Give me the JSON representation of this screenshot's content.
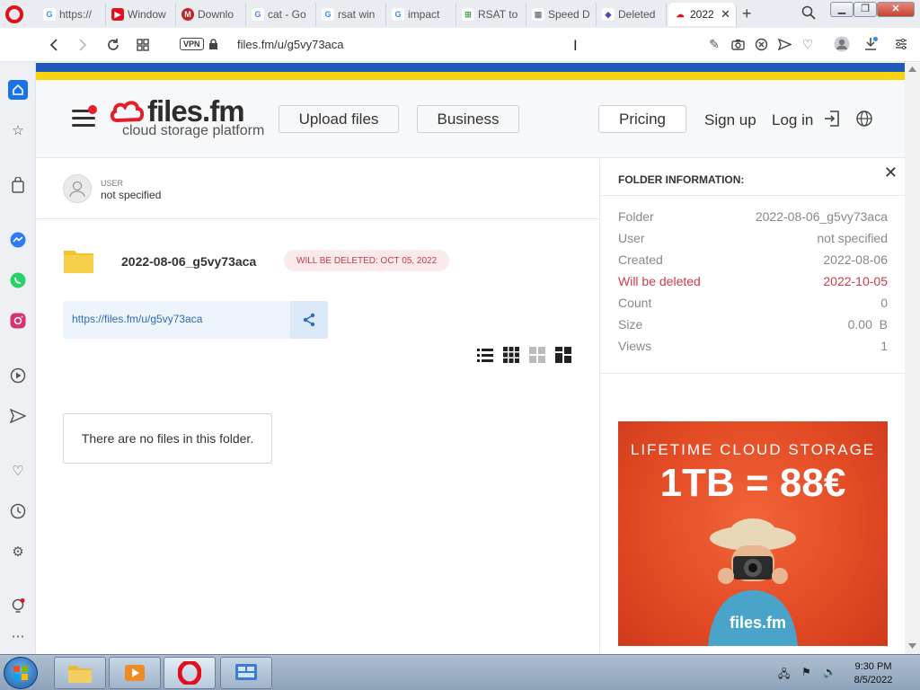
{
  "browser": {
    "tabs": [
      {
        "label": "https://",
        "fav": "G",
        "color": "#4285f4"
      },
      {
        "label": "Window",
        "fav": "▶",
        "color": "#e0101e"
      },
      {
        "label": "Downlo",
        "fav": "M",
        "color": "#c4222a"
      },
      {
        "label": "cat - Go",
        "fav": "G",
        "color": "#4285f4"
      },
      {
        "label": "rsat win",
        "fav": "G",
        "color": "#4285f4"
      },
      {
        "label": "impact",
        "fav": "G",
        "color": "#4285f4"
      },
      {
        "label": "RSAT to",
        "fav": "⊞",
        "color": "#3aa757"
      },
      {
        "label": "Speed D",
        "fav": "▦",
        "color": "#7a8593"
      },
      {
        "label": "Deleted",
        "fav": "◆",
        "color": "#5b3fb0"
      },
      {
        "label": "2022",
        "fav": "☁",
        "color": "#e0101e"
      }
    ],
    "url": "files.fm/u/g5vy73aca",
    "vpn_label": "VPN"
  },
  "header": {
    "logo_name": "files.fm",
    "logo_tagline": "cloud storage platform",
    "upload_label": "Upload files",
    "business_label": "Business",
    "pricing_label": "Pricing",
    "signup_label": "Sign up",
    "login_label": "Log in"
  },
  "folder": {
    "user_caption": "USER",
    "user_value": "not specified",
    "name": "2022-08-06_g5vy73aca",
    "delete_badge": "WILL BE DELETED: OCT 05, 2022",
    "link": "https://files.fm/u/g5vy73aca",
    "empty_message": "There are no files in this folder."
  },
  "panel": {
    "title": "FOLDER INFORMATION:",
    "rows": [
      {
        "key": "Folder",
        "value": "2022-08-06_g5vy73aca"
      },
      {
        "key": "User",
        "value": "not specified"
      },
      {
        "key": "Created",
        "value": "2022-08-06"
      },
      {
        "key": "Will be deleted",
        "value": "2022-10-05"
      },
      {
        "key": "Count",
        "value": "0"
      },
      {
        "key": "Size",
        "value": "0.00  B"
      },
      {
        "key": "Views",
        "value": "1"
      }
    ]
  },
  "ad": {
    "line1": "LIFETIME CLOUD STORAGE",
    "line2": "1TB = 88€",
    "logo": "files.fm"
  },
  "taskbar": {
    "time": "9:30 PM",
    "date": "8/5/2022"
  }
}
